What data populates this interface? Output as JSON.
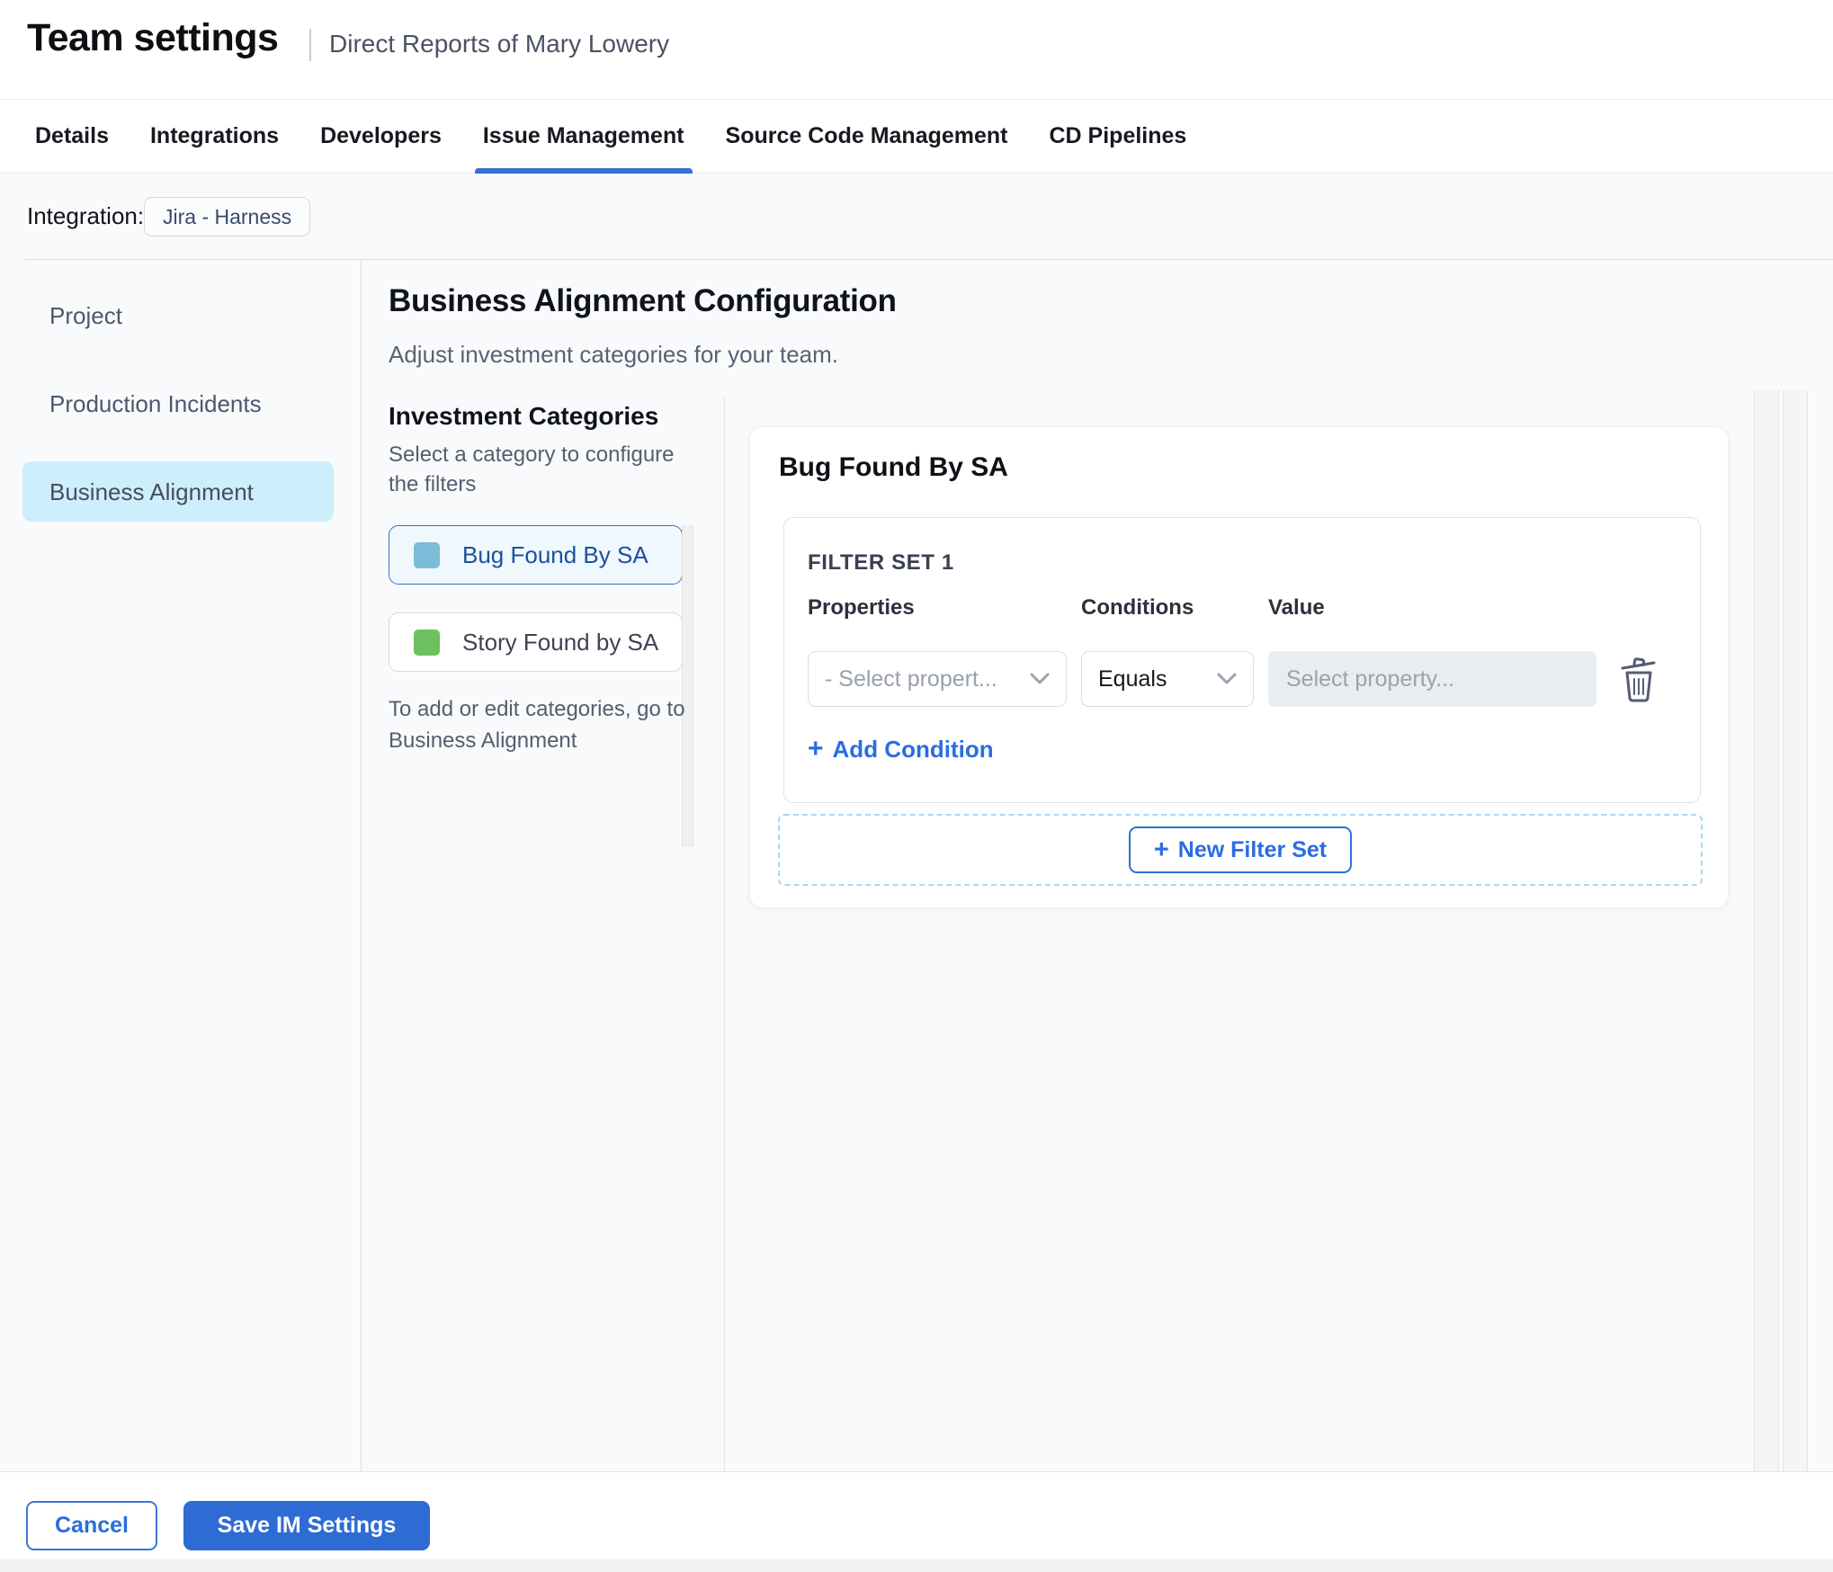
{
  "header": {
    "title": "Team settings",
    "subtitle": "Direct Reports of Mary Lowery"
  },
  "tabs": {
    "items": [
      {
        "label": "Details",
        "active": false
      },
      {
        "label": "Integrations",
        "active": false
      },
      {
        "label": "Developers",
        "active": false
      },
      {
        "label": "Issue Management",
        "active": true
      },
      {
        "label": "Source Code Management",
        "active": false
      },
      {
        "label": "CD Pipelines",
        "active": false
      }
    ]
  },
  "integration": {
    "label": "Integration:",
    "chip": "Jira - Harness"
  },
  "sidebar": {
    "items": [
      {
        "label": "Project",
        "active": false
      },
      {
        "label": "Production Incidents",
        "active": false
      },
      {
        "label": "Business Alignment",
        "active": true
      }
    ]
  },
  "main": {
    "title": "Business Alignment Configuration",
    "subtitle": "Adjust investment categories for your team.",
    "categories": {
      "heading": "Investment Categories",
      "description": "Select a category to configure the filters",
      "items": [
        {
          "label": "Bug Found By SA",
          "swatch_color": "#7cbcd9",
          "selected": true
        },
        {
          "label": "Story Found by SA",
          "swatch_color": "#6cc05e",
          "selected": false
        }
      ],
      "footnote": "To add or edit categories, go to Business Alignment"
    },
    "panel": {
      "title": "Bug Found By SA",
      "filter_set": {
        "title": "FILTER SET 1",
        "columns": {
          "properties": "Properties",
          "conditions": "Conditions",
          "value": "Value"
        },
        "row": {
          "property_placeholder": "- Select propert...",
          "condition_value": "Equals",
          "value_placeholder": "Select property..."
        },
        "add_condition_label": "Add Condition",
        "plus_glyph": "+"
      },
      "new_filter_set_label": "New Filter Set"
    }
  },
  "footer": {
    "cancel_label": "Cancel",
    "save_label": "Save IM Settings"
  },
  "icons": {
    "dropdown": "chevron-down",
    "delete_condition": "trash",
    "add": "plus"
  },
  "colors": {
    "accent_blue": "#2a6de0",
    "tab_underline": "#3570d2",
    "save_button_bg": "#2f6bd4",
    "nav_selected_bg": "#cdeefb",
    "category_selected_bg": "#eef8fd",
    "category_selected_border": "#3b6fc6",
    "dashed_border": "#a9d9f2",
    "content_bg": "#f8fafc",
    "bug_swatch": "#7cbcd9",
    "story_swatch": "#6cc05e"
  }
}
